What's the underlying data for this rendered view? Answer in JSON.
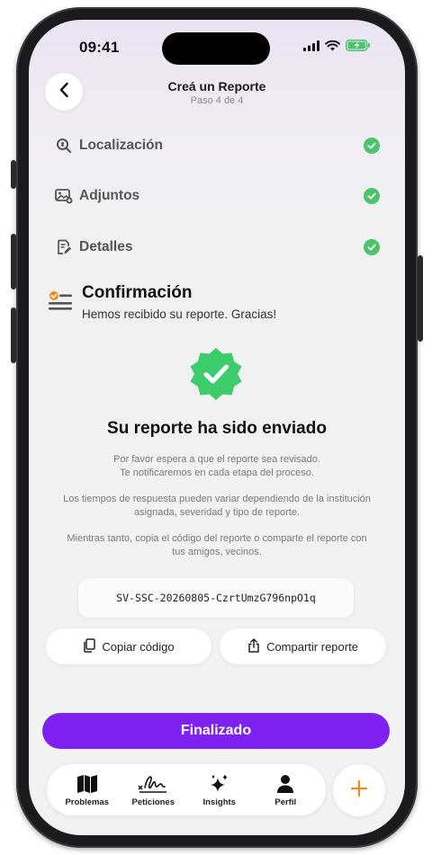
{
  "status_bar": {
    "time": "09:41"
  },
  "header": {
    "title": "Creá un Reporte",
    "subtitle": "Paso 4 de 4"
  },
  "steps": [
    {
      "label": "Localización",
      "icon": "location-search-icon",
      "done": true
    },
    {
      "label": "Adjuntos",
      "icon": "image-attachment-icon",
      "done": true
    },
    {
      "label": "Detalles",
      "icon": "document-edit-icon",
      "done": true
    }
  ],
  "confirmation": {
    "title": "Confirmación",
    "subtitle": "Hemos recibido su reporte. Gracias!"
  },
  "result": {
    "title": "Su reporte ha sido enviado",
    "para1_line1": "Por favor espera a que el reporte sea revisado.",
    "para1_line2": "Te notificaremos en cada etapa del proceso.",
    "para2_line1": "Los tiempos de respuesta pueden variar dependiendo de la institución",
    "para2_line2": "asignada, severidad y tipo de reporte.",
    "para3_line1": "Mientras tanto, copia el código del reporte o comparte el reporte con",
    "para3_line2": "tus amigos, vecinos."
  },
  "report_code": "SV-SSC-20260805-CzrtUmzG796npO1q",
  "actions": {
    "copy_label": "Copiar código",
    "share_label": "Compartir reporte"
  },
  "finish_label": "Finalizado",
  "tabs": [
    {
      "label": "Problemas",
      "icon": "map-icon"
    },
    {
      "label": "Peticiones",
      "icon": "signature-icon"
    },
    {
      "label": "Insights",
      "icon": "sparkles-icon"
    },
    {
      "label": "Perfil",
      "icon": "person-icon"
    }
  ],
  "colors": {
    "accent": "#7f21f2",
    "success": "#4cc46b",
    "plus": "#f08a1c"
  }
}
